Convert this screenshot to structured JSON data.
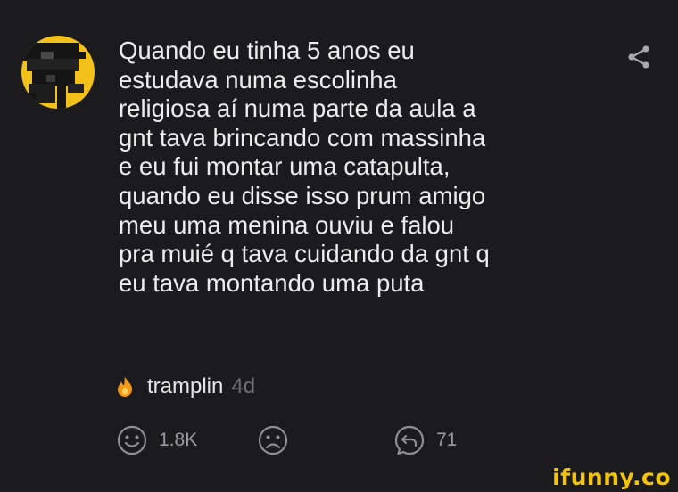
{
  "post": {
    "text": "Quando eu tinha 5 anos eu\nestudava numa escolinha\nreligiosa aí numa parte da aula a\ngnt tava brincando com massinha\ne eu fui montar uma catapulta,\nquando eu disse isso prum amigo\nmeu uma menina ouviu e falou\npra muié q tava cuidando da gnt q\neu tava montando uma puta"
  },
  "author": {
    "username": "tramplin",
    "badge_icon": "flame-icon",
    "time_ago": "4d"
  },
  "actions": {
    "likes": "1.8K",
    "replies": "71"
  },
  "watermark": "ifunny.co",
  "colors": {
    "background": "#1b1b1e",
    "text": "#ececec",
    "muted": "#6f6f74",
    "accent": "#f4c40a"
  }
}
